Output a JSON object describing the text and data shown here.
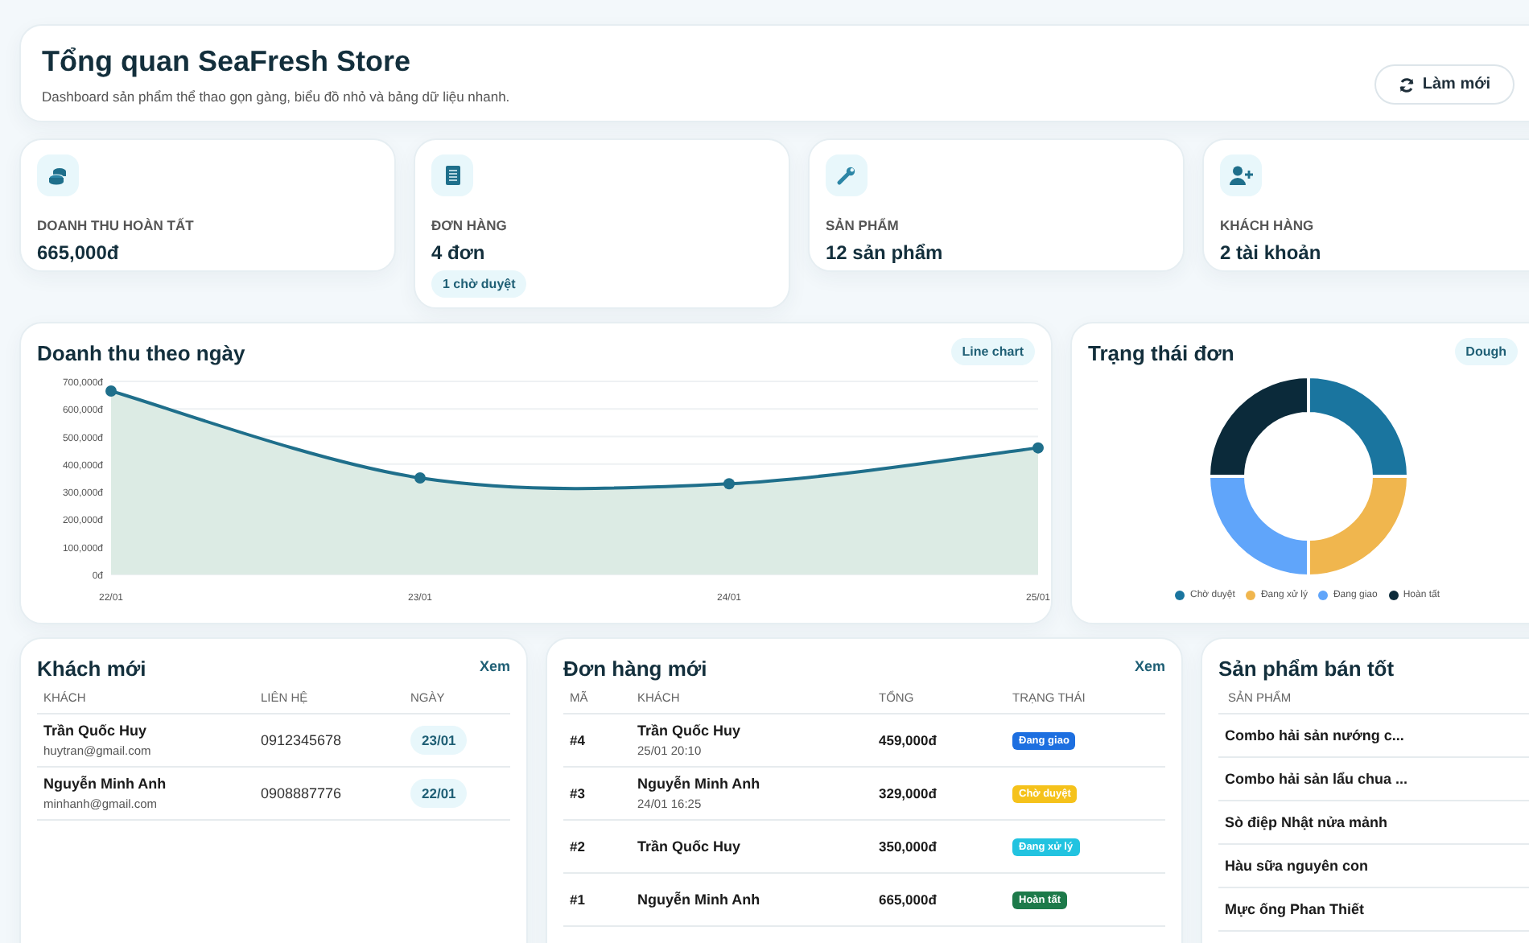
{
  "header": {
    "title": "Tổng quan SeaFresh Store",
    "subtitle": "Dashboard sản phẩm thể thao gọn gàng, biểu đồ nhỏ và bảng dữ liệu nhanh.",
    "refresh_button": "Làm mới"
  },
  "stats": [
    {
      "kind": "coins",
      "label": "DOANH THU HOÀN TẤT",
      "value": "665,000đ"
    },
    {
      "kind": "receipt",
      "label": "ĐƠN HÀNG",
      "value": "4 đơn",
      "badge": "1 chờ duyệt"
    },
    {
      "kind": "tool",
      "label": "SẢN PHẨM",
      "value": "12 sản phẩm"
    },
    {
      "kind": "user",
      "label": "KHÁCH HÀNG",
      "value": "2 tài khoản"
    }
  ],
  "revenue_chart": {
    "title": "Doanh thu theo ngày",
    "badge": "Line chart",
    "chart_data": {
      "type": "area",
      "categories": [
        "22/01",
        "23/01",
        "24/01",
        "25/01"
      ],
      "series": [
        {
          "color": "#1f6f8b",
          "values": [
            665000,
            350000,
            329000,
            459000
          ]
        }
      ],
      "grid": true,
      "ylim": [
        0,
        700000
      ],
      "yticks": [
        {
          "value": 0,
          "label": "0đ"
        },
        {
          "value": 100000,
          "label": "100,000đ"
        },
        {
          "value": 200000,
          "label": "200,000đ"
        },
        {
          "value": 300000,
          "label": "300,000đ"
        },
        {
          "value": 400000,
          "label": "400,000đ"
        },
        {
          "value": 500000,
          "label": "500,000đ"
        },
        {
          "value": 600000,
          "label": "600,000đ"
        },
        {
          "value": 700000,
          "label": "700,000đ"
        }
      ]
    }
  },
  "status_chart": {
    "title": "Trạng thái đơn",
    "badge": "Dough",
    "chart_data": {
      "type": "donut",
      "categories": [
        "Chờ duyệt",
        "Đang xử lý",
        "Đang giao",
        "Hoàn tất"
      ],
      "values": [
        25,
        25,
        25,
        25
      ],
      "colors": [
        "#1a759f",
        "#f0b64e",
        "#60a5fa",
        "#0b2a3a"
      ],
      "legend": "bottom"
    }
  },
  "new_customers": {
    "title": "Khách mới",
    "link": "Xem",
    "columns": [
      "KHÁCH",
      "LIÊN HỆ",
      "NGÀY"
    ],
    "rows": [
      {
        "name": "Trần Quốc Huy",
        "email": "huytran@gmail.com",
        "phone": "0912345678",
        "date": "23/01"
      },
      {
        "name": "Nguyễn Minh Anh",
        "email": "minhanh@gmail.com",
        "phone": "0908887776",
        "date": "22/01"
      }
    ]
  },
  "new_orders": {
    "title": "Đơn hàng mới",
    "link": "Xem",
    "columns": [
      "MÃ",
      "KHÁCH",
      "TỔNG",
      "TRẠNG THÁI"
    ],
    "rows": [
      {
        "id": "#4",
        "customer": "Trần Quốc Huy",
        "time": "25/01 20:10",
        "total": "459,000đ",
        "status": "Đang giao",
        "color": "#1d6fe0"
      },
      {
        "id": "#3",
        "customer": "Nguyễn Minh Anh",
        "time": "24/01 16:25",
        "total": "329,000đ",
        "status": "Chờ duyệt",
        "color": "#f5c21b"
      },
      {
        "id": "#2",
        "customer": "Trần Quốc Huy",
        "total": "350,000đ",
        "status": "Đang xử lý",
        "color": "#22c3e0"
      },
      {
        "id": "#1",
        "customer": "Nguyễn Minh Anh",
        "total": "665,000đ",
        "status": "Hoàn tất",
        "color": "#1d7a4a"
      }
    ]
  },
  "best_sellers": {
    "title": "Sản phẩm bán tốt",
    "columns": [
      "SẢN PHẨM"
    ],
    "rows": [
      "Combo hải sản nướng c...",
      "Combo hải sản lẩu chua ...",
      "Sò điệp Nhật nửa mảnh",
      "Hàu sữa nguyên con",
      "Mực ống Phan Thiết"
    ]
  }
}
